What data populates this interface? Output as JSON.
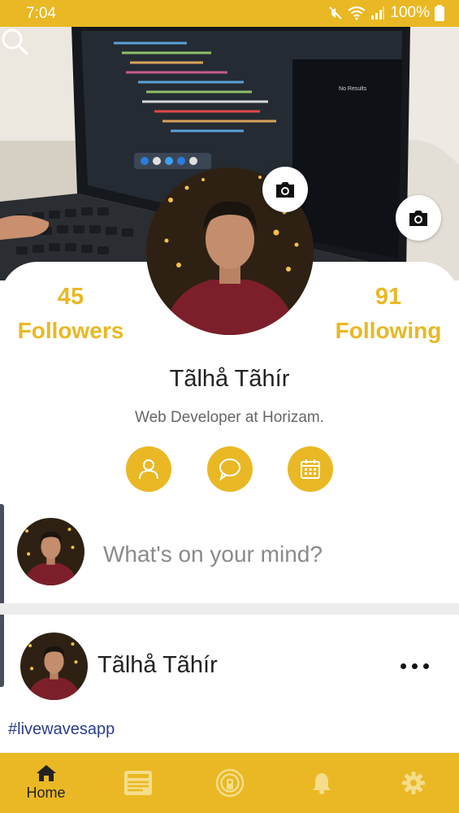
{
  "status_bar": {
    "time": "7:04",
    "battery": "100%"
  },
  "cover": {
    "screen_text": "No Results",
    "search_icon": "search-icon"
  },
  "profile": {
    "followers_count": "45",
    "followers_label": "Followers",
    "following_count": "91",
    "following_label": "Following",
    "name": "Tãlhå Tãhír",
    "bio": "Web Developer at Horizam."
  },
  "actions": [
    {
      "icon": "person-icon"
    },
    {
      "icon": "chat-bubble-icon"
    },
    {
      "icon": "calendar-icon"
    }
  ],
  "composer": {
    "placeholder": "What's on your mind?"
  },
  "post": {
    "author": "Tãlhå Tãhír",
    "hashtag": "#livewavesapp"
  },
  "bottom_nav": {
    "items": [
      {
        "icon": "home-icon",
        "label": "Home"
      },
      {
        "icon": "newspaper-icon",
        "label": ""
      },
      {
        "icon": "live-broadcast-icon",
        "label": ""
      },
      {
        "icon": "bell-icon",
        "label": ""
      },
      {
        "icon": "gear-icon",
        "label": ""
      }
    ]
  },
  "colors": {
    "accent": "#e9b824",
    "hashtag": "#2b3c8f",
    "text": "#222222"
  }
}
